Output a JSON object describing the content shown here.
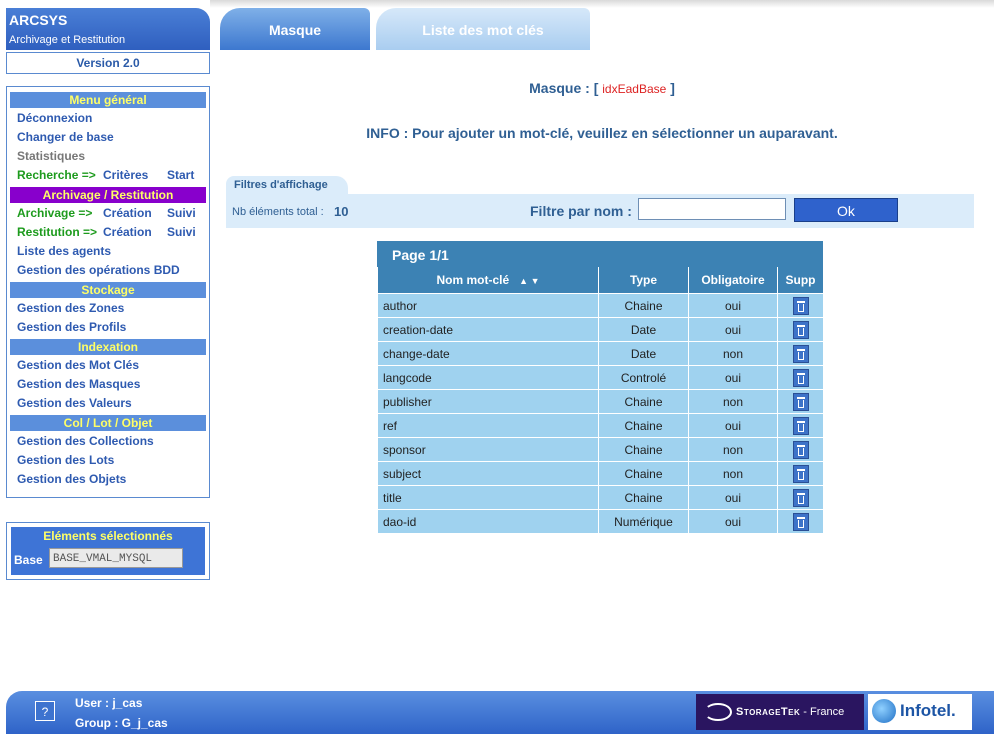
{
  "brand": {
    "name": "ARCSYS",
    "subtitle": "Archivage et Restitution",
    "version": "Version 2.0"
  },
  "tabs": [
    {
      "label": "Masque"
    },
    {
      "label": "Liste des mot clés"
    }
  ],
  "sidebar": {
    "headers": {
      "general": "Menu général",
      "archivage": "Archivage / Restitution",
      "stockage": "Stockage",
      "indexation": "Indexation",
      "col_lot_objet": "Col / Lot / Objet"
    },
    "items": {
      "deconnexion": "Déconnexion",
      "changer_base": "Changer de base",
      "statistiques": "Statistiques",
      "recherche": "Recherche =>",
      "criteres": "Critères",
      "start": "Start",
      "archivage": "Archivage =>",
      "restitution": "Restitution =>",
      "creation": "Création",
      "suivi": "Suivi",
      "liste_agents": "Liste des agents",
      "gestion_operations": "Gestion des opérations BDD",
      "gestion_zones": "Gestion des Zones",
      "gestion_profils": "Gestion des Profils",
      "gestion_mot_cles": "Gestion des Mot Clés",
      "gestion_masques": "Gestion des Masques",
      "gestion_valeurs": "Gestion des Valeurs",
      "gestion_collections": "Gestion des Collections",
      "gestion_lots": "Gestion des Lots",
      "gestion_objets": "Gestion des Objets"
    },
    "selected": {
      "title": "Eléments sélectionnés",
      "base_label": "Base",
      "base_value": "BASE_VMAL_MYSQL"
    }
  },
  "main": {
    "masque_prefix": "Masque : [",
    "masque_value": "idxEadBase",
    "masque_suffix": "]",
    "info": "INFO : Pour ajouter un mot-clé, veuillez en sélectionner un auparavant.",
    "filter_tab": "Filtres d'affichage",
    "nb_label": "Nb éléments total :",
    "nb_value": "10",
    "filter_label": "Filtre par nom :",
    "filter_value": "",
    "ok_label": "Ok"
  },
  "table": {
    "page": "Page 1/1",
    "sort_arrows": "▲ ▼",
    "headers": [
      "Nom mot-clé",
      "Type",
      "Obligatoire",
      "Supp"
    ],
    "rows": [
      [
        "author",
        "Chaine",
        "oui"
      ],
      [
        "creation-date",
        "Date",
        "oui"
      ],
      [
        "change-date",
        "Date",
        "non"
      ],
      [
        "langcode",
        "Controlé",
        "oui"
      ],
      [
        "publisher",
        "Chaine",
        "non"
      ],
      [
        "ref",
        "Chaine",
        "oui"
      ],
      [
        "sponsor",
        "Chaine",
        "non"
      ],
      [
        "subject",
        "Chaine",
        "non"
      ],
      [
        "title",
        "Chaine",
        "oui"
      ],
      [
        "dao-id",
        "Numérique",
        "oui"
      ]
    ],
    "delete_icon": "trash-icon"
  },
  "footer": {
    "help": "?",
    "user": "User : j_cas",
    "group": "Group : G_j_cas",
    "storagetek_text": "StorageTek",
    "storagetek_suffix": " - France",
    "infotel_text": "Infotel."
  }
}
